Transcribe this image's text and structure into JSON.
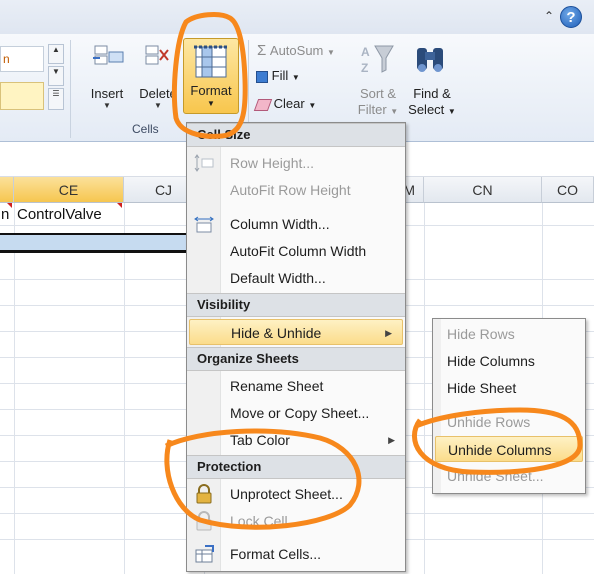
{
  "titlebar": {
    "help_glyph": "?",
    "minimize_glyph": "^"
  },
  "ribbon": {
    "style_preview_text": "n",
    "insert_label": "Insert",
    "delete_label": "Delete",
    "format_label": "Format",
    "cells_group_label": "Cells",
    "autosum_label": "AutoSum",
    "fill_label": "Fill",
    "clear_label": "Clear",
    "sort_label_1": "Sort &",
    "sort_label_2": "Filter",
    "find_label_1": "Find &",
    "find_label_2": "Select"
  },
  "sheet": {
    "columns": [
      {
        "label": "",
        "selected": true
      },
      {
        "label": "CE",
        "selected": true
      },
      {
        "label": "CJ",
        "selected": false
      },
      {
        "label": "M",
        "selected": false
      },
      {
        "label": "CN",
        "selected": false
      },
      {
        "label": "CO",
        "selected": false
      }
    ],
    "cells": {
      "left_fragment": "n",
      "ce_value": "ControlValve"
    }
  },
  "format_menu": {
    "sections": {
      "cell_size": "Cell Size",
      "visibility": "Visibility",
      "organize": "Organize Sheets",
      "protection": "Protection"
    },
    "items": {
      "row_height": "Row Height...",
      "autofit_row": "AutoFit Row Height",
      "column_width": "Column Width...",
      "autofit_column": "AutoFit Column Width",
      "default_width": "Default Width...",
      "hide_unhide": "Hide & Unhide",
      "rename_sheet": "Rename Sheet",
      "move_copy": "Move or Copy Sheet...",
      "tab_color": "Tab Color",
      "unprotect": "Unprotect Sheet...",
      "lock_cell": "Lock Cell",
      "format_cells": "Format Cells..."
    }
  },
  "hide_submenu": {
    "hide_rows": "Hide Rows",
    "hide_columns": "Hide Columns",
    "hide_sheet": "Hide Sheet",
    "unhide_rows": "Unhide Rows",
    "unhide_columns": "Unhide Columns",
    "unhide_sheet": "Unhide Sheet..."
  },
  "colors": {
    "annotation_orange": "#f7881c",
    "highlight": "#fbdc8b",
    "selection_blue": "#c6dbf0"
  }
}
